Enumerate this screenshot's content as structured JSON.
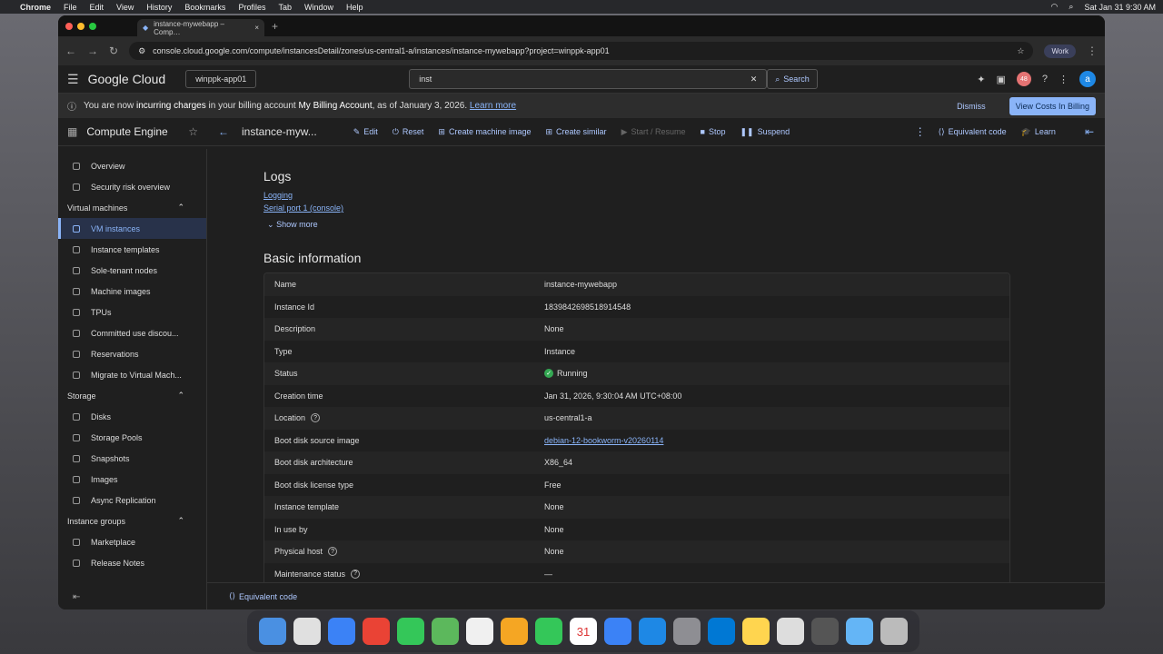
{
  "macos": {
    "menus": [
      "Chrome",
      "File",
      "Edit",
      "View",
      "History",
      "Bookmarks",
      "Profiles",
      "Tab",
      "Window",
      "Help"
    ],
    "clock": "Sat Jan 31  9:30 AM"
  },
  "browser": {
    "tab_title": "instance-mywebapp – Comp…",
    "url": "console.cloud.google.com/compute/instancesDetail/zones/us-central1-a/instances/instance-mywebapp?project=winppk-app01",
    "profile": "Work"
  },
  "header": {
    "brand": "Google Cloud",
    "project": "winppk-app01",
    "search_value": "inst",
    "search_button": "Search",
    "notif_count": "48",
    "avatar": "a"
  },
  "banner": {
    "pre": "You are now",
    "bold1": "incurring charges",
    "mid": "in your billing account",
    "bold2": "My Billing Account",
    "post": ", as of January 3, 2026.",
    "learn": "Learn more",
    "dismiss": "Dismiss",
    "view_costs": "View Costs In Billing"
  },
  "toolbar": {
    "service": "Compute Engine",
    "page_title": "instance-myw...",
    "edit": "Edit",
    "reset": "Reset",
    "create_image": "Create machine image",
    "create_similar": "Create similar",
    "start": "Start / Resume",
    "stop": "Stop",
    "suspend": "Suspend",
    "equiv": "Equivalent code",
    "learn": "Learn"
  },
  "sidebar": {
    "top": [
      {
        "label": "Overview"
      },
      {
        "label": "Security risk overview"
      }
    ],
    "vm_head": "Virtual machines",
    "vm": [
      {
        "label": "VM instances"
      },
      {
        "label": "Instance templates"
      },
      {
        "label": "Sole-tenant nodes"
      },
      {
        "label": "Machine images"
      },
      {
        "label": "TPUs"
      },
      {
        "label": "Committed use discou..."
      },
      {
        "label": "Reservations"
      },
      {
        "label": "Migrate to Virtual Mach..."
      }
    ],
    "storage_head": "Storage",
    "storage": [
      {
        "label": "Disks"
      },
      {
        "label": "Storage Pools"
      },
      {
        "label": "Snapshots"
      },
      {
        "label": "Images"
      },
      {
        "label": "Async Replication"
      }
    ],
    "groups_head": "Instance groups",
    "bottom": [
      {
        "label": "Marketplace"
      },
      {
        "label": "Release Notes"
      }
    ]
  },
  "logs": {
    "title": "Logs",
    "link1": "Logging",
    "link2": "Serial port 1 (console)",
    "show_more": "Show more"
  },
  "basic": {
    "title": "Basic information",
    "rows": [
      {
        "k": "Name",
        "v": "instance-mywebapp"
      },
      {
        "k": "Instance Id",
        "v": "1839842698518914548"
      },
      {
        "k": "Description",
        "v": "None"
      },
      {
        "k": "Type",
        "v": "Instance"
      },
      {
        "k": "Status",
        "v": "Running"
      },
      {
        "k": "Creation time",
        "v": "Jan 31, 2026, 9:30:04 AM UTC+08:00"
      },
      {
        "k": "Location",
        "v": "us-central1-a"
      },
      {
        "k": "Boot disk source image",
        "v": "debian-12-bookworm-v20260114"
      },
      {
        "k": "Boot disk architecture",
        "v": "X86_64"
      },
      {
        "k": "Boot disk license type",
        "v": "Free"
      },
      {
        "k": "Instance template",
        "v": "None"
      },
      {
        "k": "In use by",
        "v": "None"
      },
      {
        "k": "Physical host",
        "v": "None"
      },
      {
        "k": "Maintenance status",
        "v": "—"
      }
    ]
  },
  "footer": {
    "equiv": "Equivalent code"
  },
  "dock": {
    "date_day": "31"
  }
}
